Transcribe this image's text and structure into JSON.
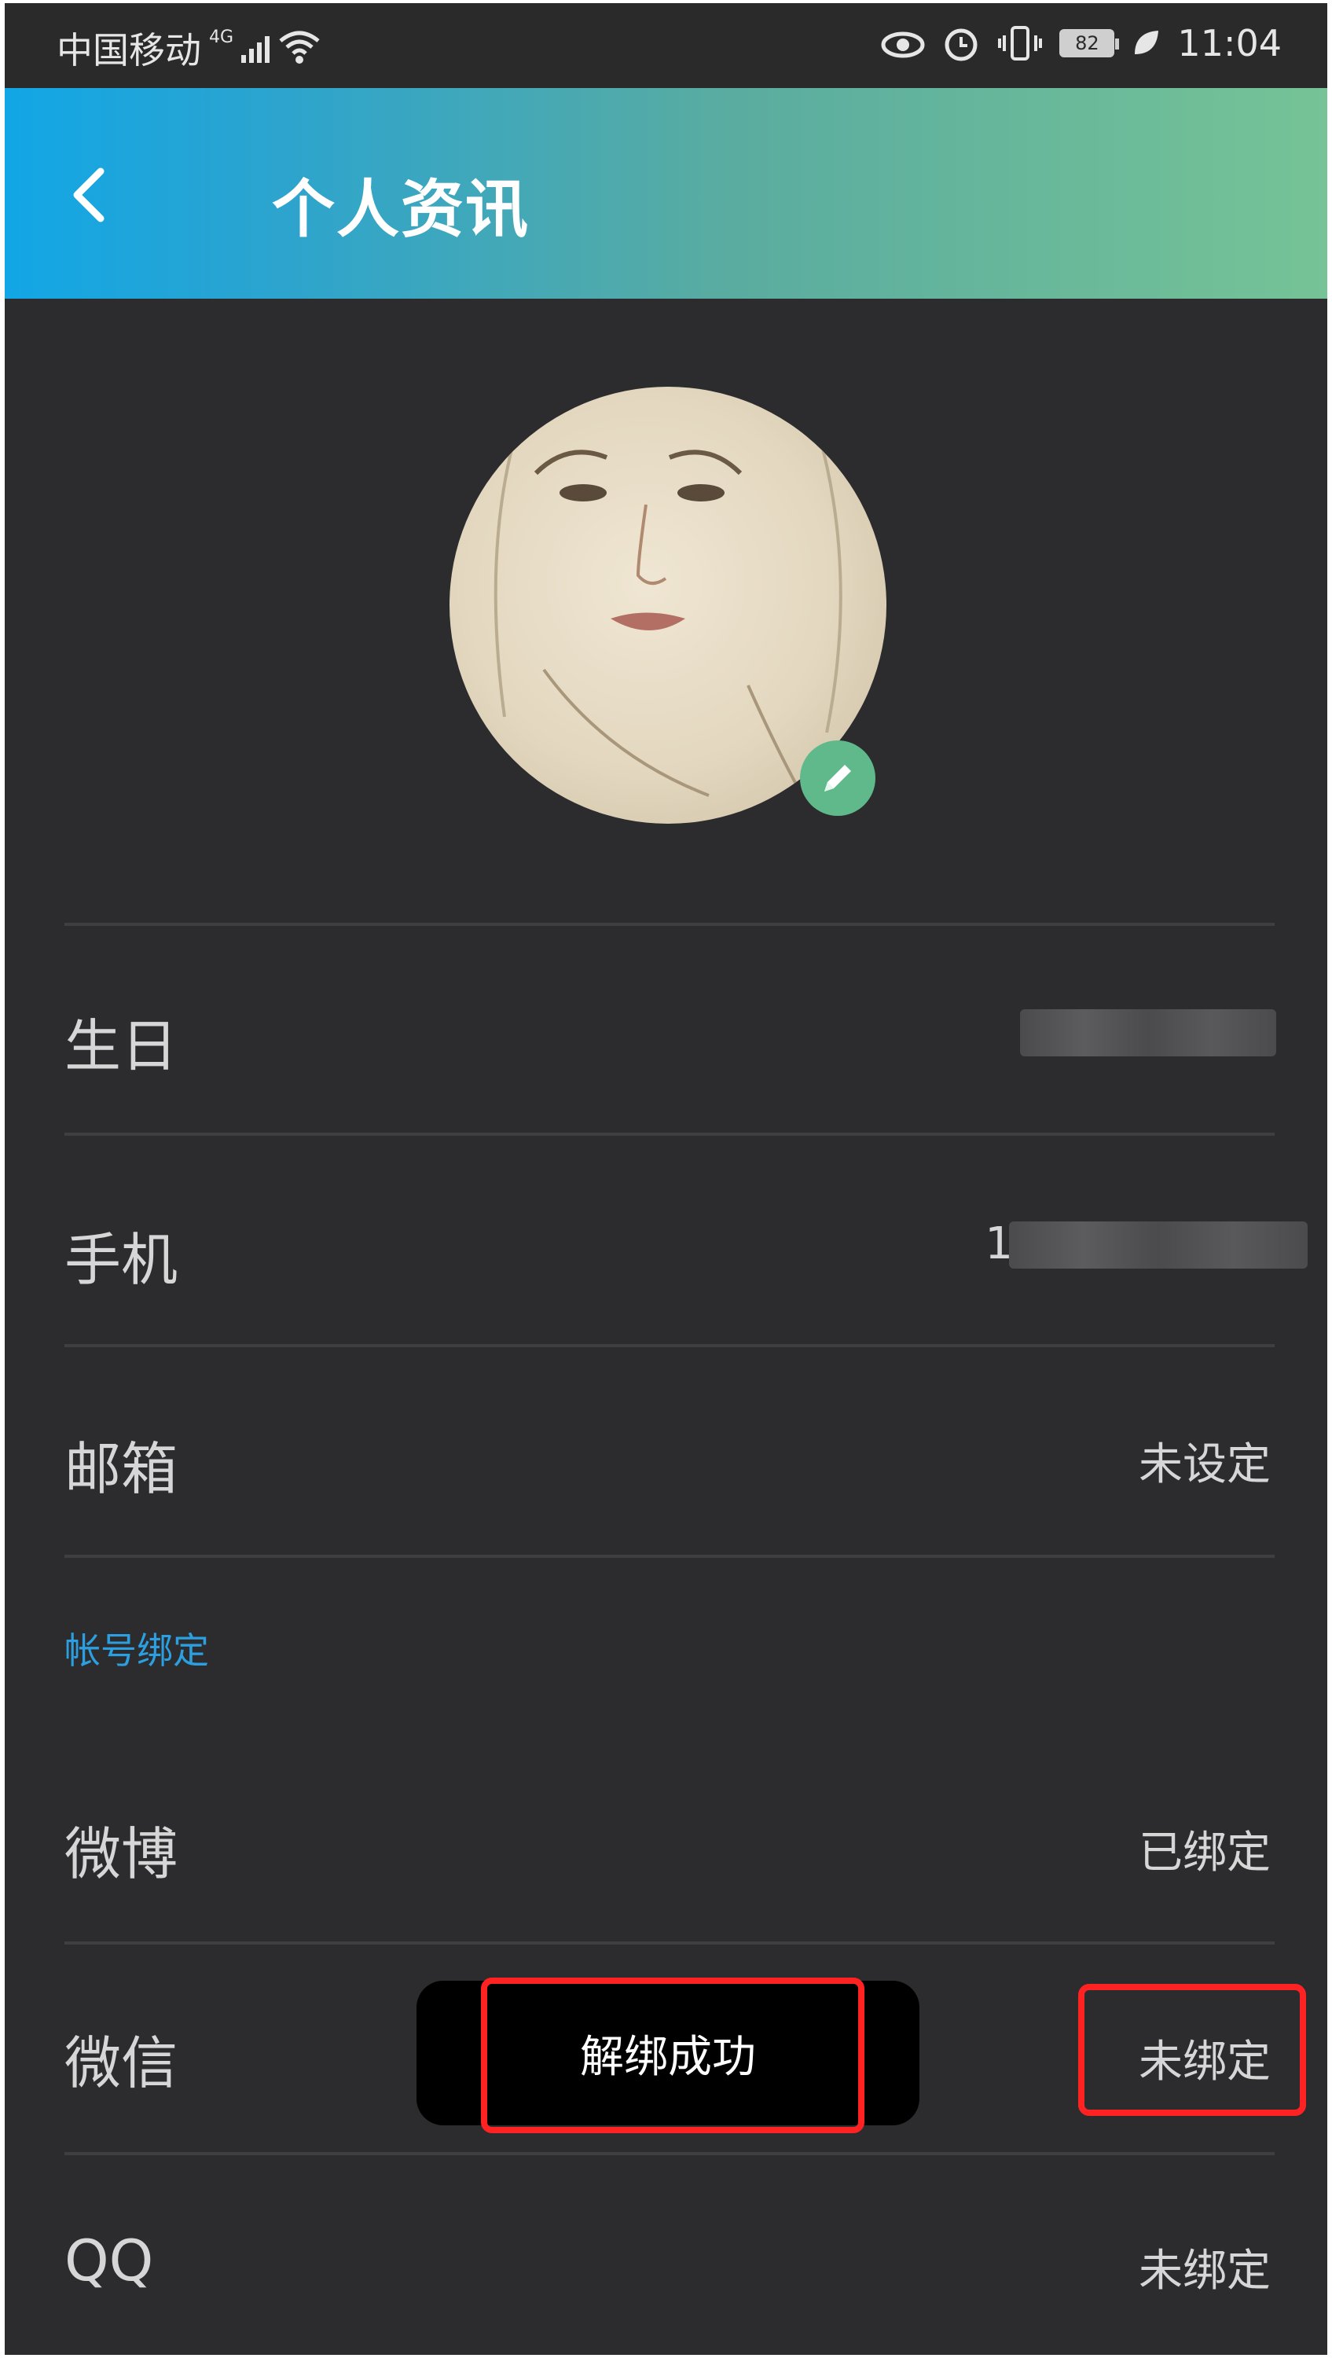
{
  "status_bar": {
    "carrier": "中国移动",
    "network": "4G",
    "battery": "82",
    "time": "11:04"
  },
  "app_bar": {
    "title": "个人资讯",
    "back_icon": "chevron-left-icon"
  },
  "profile": {
    "avatar_icon": "avatar-portrait",
    "edit_icon": "pencil-icon"
  },
  "rows": {
    "birthday": {
      "label": "生日",
      "value": ""
    },
    "phone": {
      "label": "手机",
      "value": "1"
    },
    "email": {
      "label": "邮箱",
      "value": "未设定"
    }
  },
  "binding": {
    "section_title": "帐号绑定",
    "weibo": {
      "label": "微博",
      "value": "已绑定"
    },
    "wechat": {
      "label": "微信",
      "value": "未绑定"
    },
    "qq": {
      "label": "QQ",
      "value": "未绑定"
    }
  },
  "toast": {
    "message": "解绑成功"
  },
  "colors": {
    "accent": "#2c9fe0",
    "highlight": "#ff2222",
    "edit_badge": "#5fb98a"
  }
}
